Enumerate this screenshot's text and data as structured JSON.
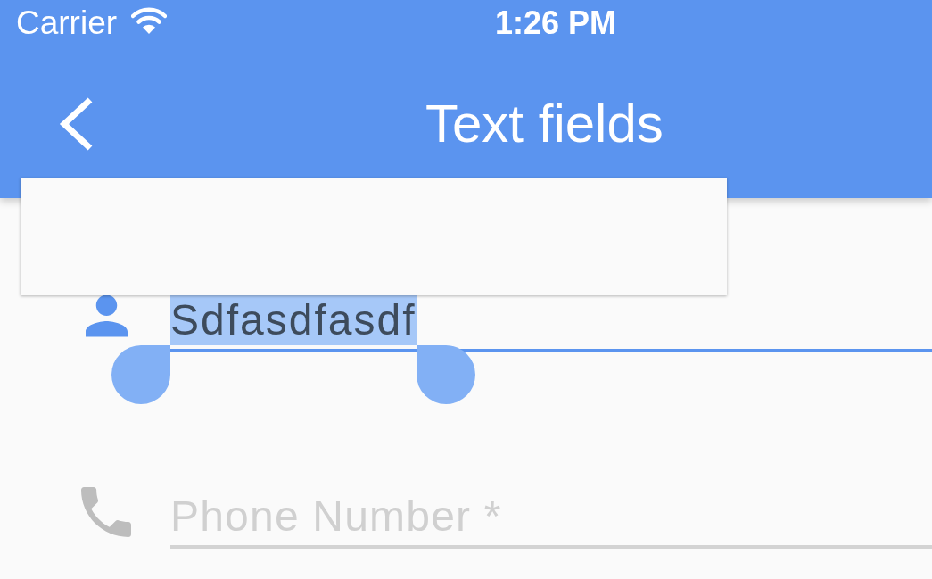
{
  "status_bar": {
    "carrier": "Carrier",
    "time": "1:26 PM"
  },
  "app_bar": {
    "title": "Text fields"
  },
  "selection_menu": {
    "open": true
  },
  "fields": [
    {
      "value": "Sdfasdfasdf",
      "focused": true,
      "text_selected": true
    },
    {
      "placeholder": "Phone Number *",
      "focused": false,
      "text_selected": false
    }
  ]
}
